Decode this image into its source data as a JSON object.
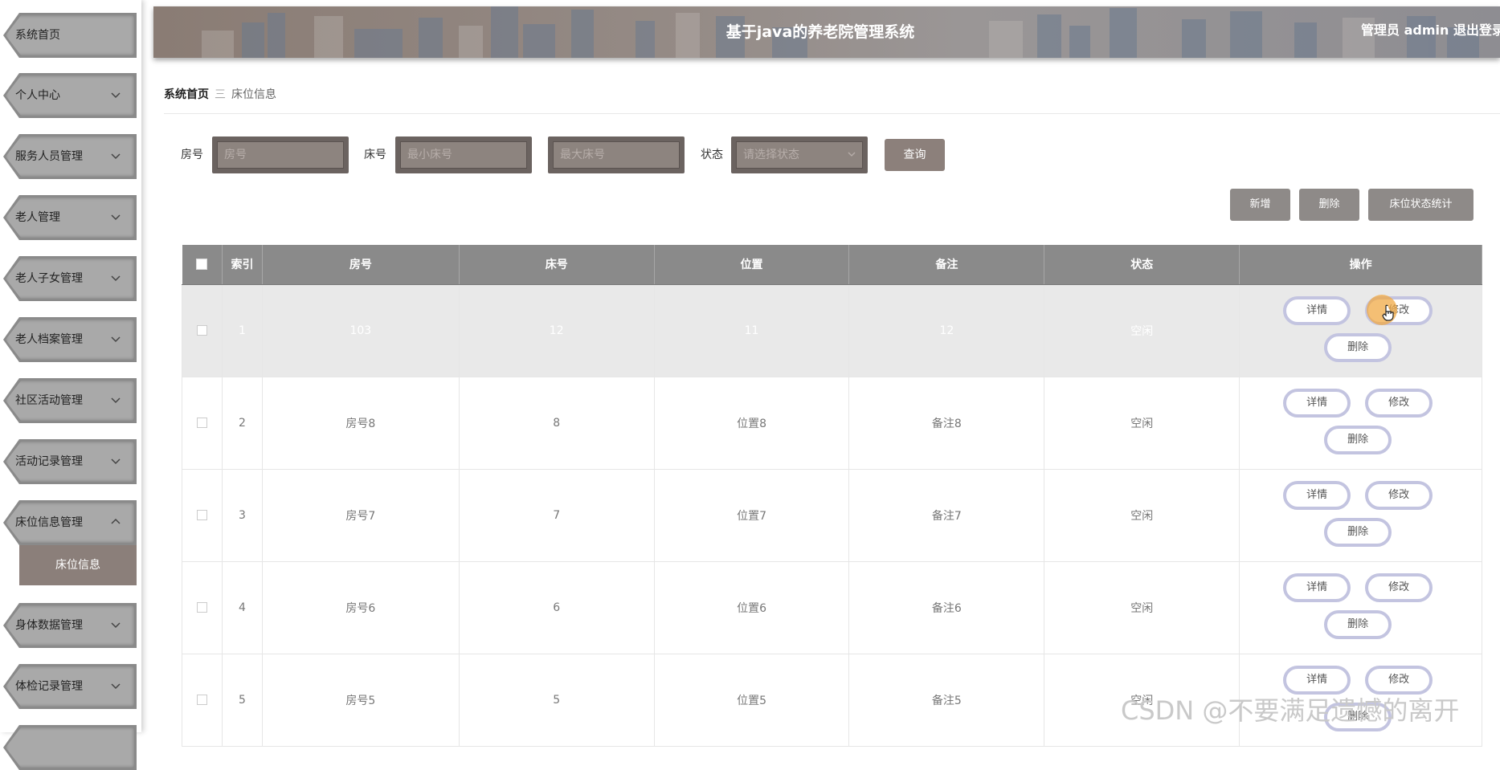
{
  "sidebar": {
    "items": [
      {
        "label": "系统首页",
        "has_chevron": false
      },
      {
        "label": "个人中心",
        "has_chevron": true
      },
      {
        "label": "服务人员管理",
        "has_chevron": true
      },
      {
        "label": "老人管理",
        "has_chevron": true
      },
      {
        "label": "老人子女管理",
        "has_chevron": true
      },
      {
        "label": "老人档案管理",
        "has_chevron": true
      },
      {
        "label": "社区活动管理",
        "has_chevron": true
      },
      {
        "label": "活动记录管理",
        "has_chevron": true
      },
      {
        "label": "床位信息管理",
        "has_chevron": true,
        "expanded": true
      },
      {
        "label": "身体数据管理",
        "has_chevron": true
      },
      {
        "label": "体检记录管理",
        "has_chevron": true
      }
    ],
    "sub_item": "床位信息"
  },
  "header": {
    "title": "基于java的养老院管理系统",
    "user": "管理员 admin",
    "logout": "退出登录"
  },
  "breadcrumb": {
    "home": "系统首页",
    "separator": "三",
    "current": "床位信息"
  },
  "search": {
    "room_label": "房号",
    "room_placeholder": "房号",
    "bed_label": "床号",
    "bed_min_placeholder": "最小床号",
    "bed_max_placeholder": "最大床号",
    "status_label": "状态",
    "status_placeholder": "请选择状态",
    "query_button": "查询"
  },
  "actions": {
    "add": "新增",
    "delete": "删除",
    "stats": "床位状态统计"
  },
  "table": {
    "columns": [
      "",
      "索引",
      "房号",
      "床号",
      "位置",
      "备注",
      "状态",
      "操作"
    ],
    "rows": [
      {
        "index": "1",
        "room": "103",
        "bed": "12",
        "position": "11",
        "note": "12",
        "status": "空闲"
      },
      {
        "index": "2",
        "room": "房号8",
        "bed": "8",
        "position": "位置8",
        "note": "备注8",
        "status": "空闲"
      },
      {
        "index": "3",
        "room": "房号7",
        "bed": "7",
        "position": "位置7",
        "note": "备注7",
        "status": "空闲"
      },
      {
        "index": "4",
        "room": "房号6",
        "bed": "6",
        "position": "位置6",
        "note": "备注6",
        "status": "空闲"
      },
      {
        "index": "5",
        "room": "房号5",
        "bed": "5",
        "position": "位置5",
        "note": "备注5",
        "status": "空闲"
      }
    ],
    "row_buttons": {
      "detail": "详情",
      "edit": "修改",
      "delete": "删除"
    }
  },
  "watermark": "CSDN @不要满足遗憾的离开",
  "colors": {
    "accent": "#8c807b",
    "table_header": "#8a8a8a",
    "sidebar_item": "#a9a9a9",
    "op_button_border": "#c3c4e0"
  }
}
